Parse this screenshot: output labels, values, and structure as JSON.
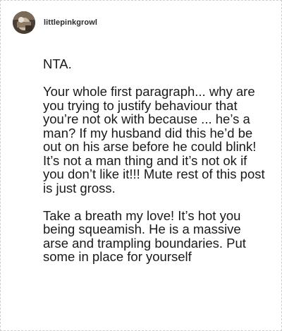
{
  "post": {
    "username": "littlepinkgrowl",
    "avatar_icon": "user-avatar-photo",
    "paragraphs": [
      "NTA.",
      "Your whole first paragraph... why are you trying to justify behaviour that you’re not ok with because ... he’s a man? If my husband did this he’d be out on his arse before he could blink! It’s not a man thing and it’s not ok if you don’t like it!!! Mute rest of this post is just gross.",
      "Take a breath my love! It’s hot you being squeamish. He is a massive arse and trampling boundaries. Put some in place for yourself"
    ]
  }
}
